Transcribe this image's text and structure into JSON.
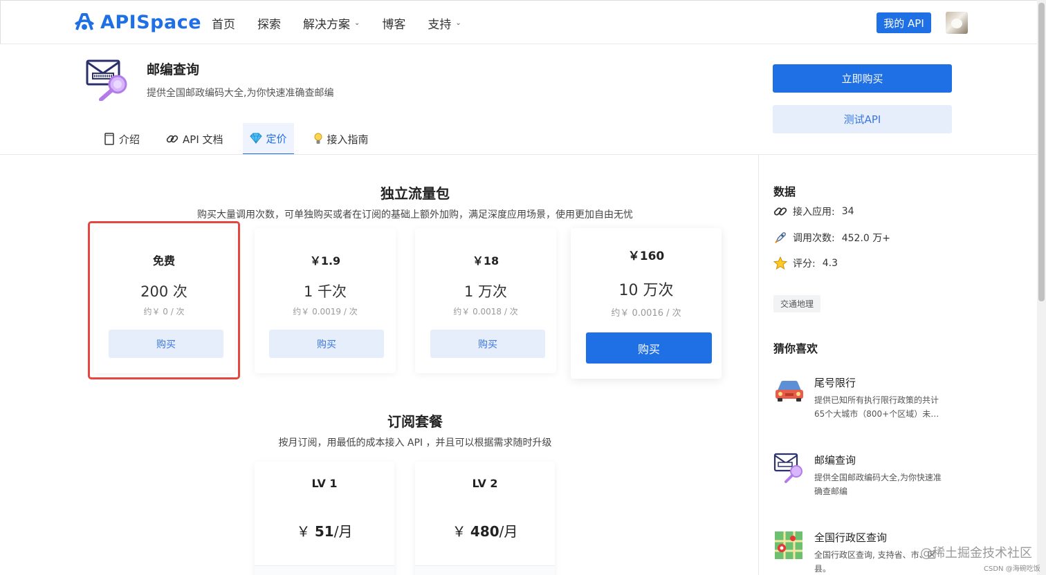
{
  "header": {
    "logo_text": "APISpace",
    "nav": [
      {
        "label": "首页",
        "has_caret": false
      },
      {
        "label": "探索",
        "has_caret": false
      },
      {
        "label": "解决方案",
        "has_caret": true
      },
      {
        "label": "博客",
        "has_caret": false
      },
      {
        "label": "支持",
        "has_caret": true
      }
    ],
    "my_api_label": "我的 API"
  },
  "product": {
    "title": "邮编查询",
    "description": "提供全国邮政编码大全,为你快速准确查邮编",
    "buy_now_label": "立即购买",
    "test_api_label": "测试API"
  },
  "tabs": [
    {
      "label": "介绍",
      "icon": "document-icon",
      "active": false
    },
    {
      "label": "API 文档",
      "icon": "link-icon",
      "active": false
    },
    {
      "label": "定价",
      "icon": "diamond-icon",
      "active": true
    },
    {
      "label": "接入指南",
      "icon": "bulb-icon",
      "active": false
    }
  ],
  "traffic": {
    "title": "独立流量包",
    "subtitle": "购买大量调用次数，可单独购买或者在订阅的基础上额外加购，满足深度应用场景，使用更加自由无忧",
    "packages": [
      {
        "price": "免费",
        "count": "200 次",
        "unit": "约￥ 0 / 次",
        "button": "购买",
        "highlighted": true
      },
      {
        "price": "￥1.9",
        "count": "1 千次",
        "unit": "约￥ 0.0019 / 次",
        "button": "购买",
        "highlighted": false
      },
      {
        "price": "￥18",
        "count": "1 万次",
        "unit": "约￥ 0.0018 / 次",
        "button": "购买",
        "highlighted": false
      },
      {
        "price": "￥160",
        "count": "10 万次",
        "unit": "约￥ 0.0016 / 次",
        "button": "购买",
        "highlighted": false
      }
    ]
  },
  "subscription": {
    "title": "订阅套餐",
    "subtitle": "按月订阅，用最低的成本接入 API ，并且可以根据需求随时升级",
    "plans": [
      {
        "level": "LV 1",
        "currency": "￥",
        "amount": "51",
        "period": "/月"
      },
      {
        "level": "LV 2",
        "currency": "￥",
        "amount": "480",
        "period": "/月"
      }
    ]
  },
  "sidebar": {
    "data_title": "数据",
    "stats": [
      {
        "label": "接入应用:",
        "value": "34",
        "icon": "link-icon"
      },
      {
        "label": "调用次数:",
        "value": "452.0 万+",
        "icon": "rocket-icon"
      },
      {
        "label": "评分:",
        "value": "4.3",
        "icon": "star-icon"
      }
    ],
    "tag": "交通地理",
    "recommend_title": "猜你喜欢",
    "recommendations": [
      {
        "title": "尾号限行",
        "description": "提供已知所有执行限行政策的共计65个大城市（800+个区域）未…",
        "icon": "car-icon"
      },
      {
        "title": "邮编查询",
        "description": "提供全国邮政编码大全,为你快速准确查邮编",
        "icon": "mail-search-icon"
      },
      {
        "title": "全国行政区查询",
        "description": "全国行政区查询, 支持省、市、区县。",
        "icon": "map-icon"
      }
    ]
  },
  "watermark": "@稀土掘金技术社区",
  "watermark_small": "CSDN @海碗吃饭",
  "colors": {
    "primary": "#1f6fe5",
    "light_button": "#e6eefc",
    "highlight_border": "#e5463f"
  }
}
